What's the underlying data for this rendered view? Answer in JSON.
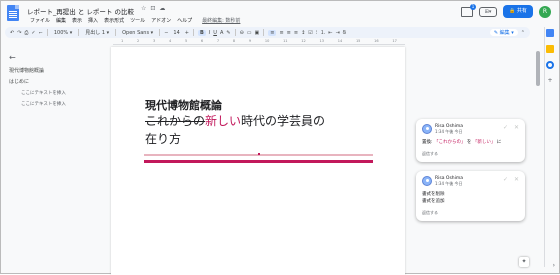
{
  "document": {
    "title": "レポート_再提出 と レポート の比較",
    "title_icons": [
      "☆",
      "⊡",
      "☁"
    ],
    "last_edit": "最終編集: 数秒前"
  },
  "menu": [
    "ファイル",
    "編集",
    "表示",
    "挿入",
    "表示形式",
    "ツール",
    "アドオン",
    "ヘルプ"
  ],
  "header": {
    "comment_count": "1",
    "present_label": "⊞▾",
    "share_label": "🔒 共有",
    "avatar_initial": "R"
  },
  "toolbar": {
    "zoom": "100%",
    "style": "見出し 1",
    "font": "Open Sans",
    "font_size": "14",
    "mode": "編集"
  },
  "ruler_ticks": [
    "1",
    "2",
    "3",
    "4",
    "5",
    "6",
    "7",
    "8",
    "9",
    "10",
    "11",
    "12",
    "13",
    "14",
    "15",
    "16",
    "17"
  ],
  "outline": {
    "items": [
      {
        "label": "現代博物館概論",
        "level": 1
      },
      {
        "label": "はじめに",
        "level": 2
      },
      {
        "label": "ここにテキストを挿入",
        "level": 3
      },
      {
        "label": "ここにテキストを挿入",
        "level": 3
      }
    ]
  },
  "page": {
    "heading": "現代博物館概論",
    "line2_struck": "これからの",
    "line2_inserted": "新しい",
    "line2_rest": "時代の学芸員の",
    "line3": "在り方"
  },
  "comments": [
    {
      "author": "Risa Oshima",
      "time": "1:34 午後 今日",
      "body_prefix": "置換:",
      "body_old": "「これからの」",
      "body_mid": "を",
      "body_new": "「新しい」",
      "body_suffix": "に",
      "reply": "返信する"
    },
    {
      "author": "Risa Oshima",
      "time": "1:34 午後 今日",
      "line1": "書式を削除",
      "line2": "書式を追加",
      "reply": "返信する"
    }
  ],
  "colors": {
    "accent": "#1a73e8",
    "suggestion": "#c2185b",
    "toolbar_bg": "#edf2fa"
  }
}
